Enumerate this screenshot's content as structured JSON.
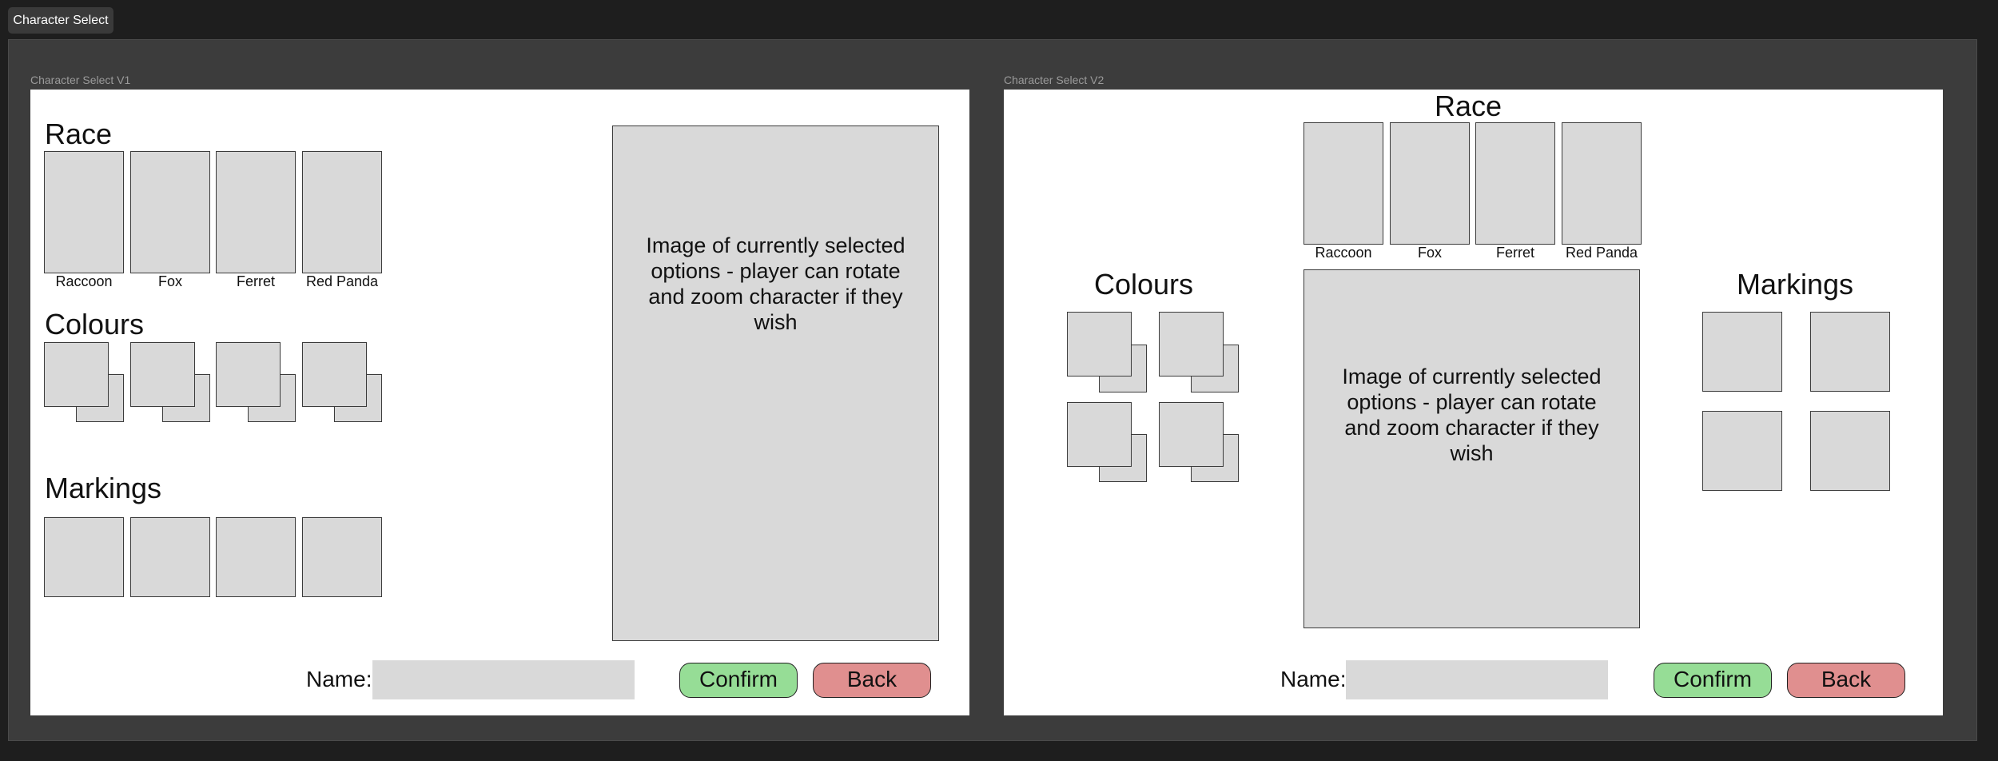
{
  "page_tab": "Character Select",
  "colors": {
    "confirm": "#96dd96",
    "back": "#e08f8f",
    "placeholder": "#d9d9d9"
  },
  "v1": {
    "label": "Character Select V1",
    "race_heading": "Race",
    "races": [
      "Raccoon",
      "Fox",
      "Ferret",
      "Red Panda"
    ],
    "colours_heading": "Colours",
    "markings_heading": "Markings",
    "preview_text": "Image of currently selected options - player can rotate and zoom character if they wish",
    "name_label": "Name:",
    "confirm": "Confirm",
    "back": "Back"
  },
  "v2": {
    "label": "Character Select V2",
    "race_heading": "Race",
    "races": [
      "Raccoon",
      "Fox",
      "Ferret",
      "Red Panda"
    ],
    "colours_heading": "Colours",
    "markings_heading": "Markings",
    "preview_text": "Image of currently selected options - player can rotate and zoom character if they wish",
    "name_label": "Name:",
    "confirm": "Confirm",
    "back": "Back"
  }
}
